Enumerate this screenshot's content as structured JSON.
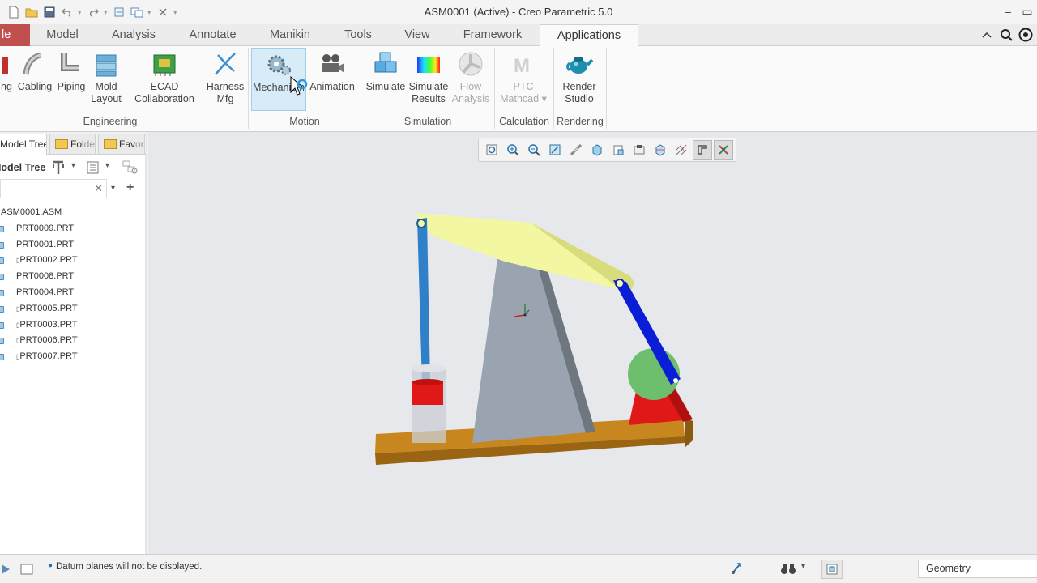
{
  "window": {
    "title": "ASM0001 (Active) - Creo Parametric 5.0"
  },
  "quick_access": [
    "new-icon",
    "open-icon",
    "save-icon",
    "undo-icon",
    "redo-icon",
    "regenerate-icon",
    "windows-icon",
    "close-icon",
    "customize-icon"
  ],
  "tabs": [
    {
      "label": "le",
      "name": "tab-file"
    },
    {
      "label": "Model",
      "name": "tab-model"
    },
    {
      "label": "Analysis",
      "name": "tab-analysis"
    },
    {
      "label": "Annotate",
      "name": "tab-annotate"
    },
    {
      "label": "Manikin",
      "name": "tab-manikin"
    },
    {
      "label": "Tools",
      "name": "tab-tools"
    },
    {
      "label": "View",
      "name": "tab-view"
    },
    {
      "label": "Framework",
      "name": "tab-framework"
    },
    {
      "label": "Applications",
      "name": "tab-applications",
      "active": true
    }
  ],
  "ribbon": {
    "buttons": [
      {
        "label1": "ng",
        "label2": ""
      },
      {
        "label1": "Cabling",
        "label2": ""
      },
      {
        "label1": "Piping",
        "label2": ""
      },
      {
        "label1": "Mold",
        "label2": "Layout"
      },
      {
        "label1": "ECAD",
        "label2": "Collaboration"
      },
      {
        "label1": "Harness",
        "label2": "Mfg"
      },
      {
        "label1": "Mechanism",
        "label2": ""
      },
      {
        "label1": "Animation",
        "label2": ""
      },
      {
        "label1": "Simulate",
        "label2": ""
      },
      {
        "label1": "Simulate",
        "label2": "Results"
      },
      {
        "label1": "Flow",
        "label2": "Analysis"
      },
      {
        "label1": "PTC",
        "label2": "Mathcad"
      },
      {
        "label1": "Render",
        "label2": "Studio"
      }
    ],
    "groups": [
      "Engineering",
      "Motion",
      "Simulation",
      "Calculation",
      "Rendering"
    ]
  },
  "left_panel": {
    "tabs": [
      {
        "label": "Model Tree",
        "hidden": ""
      },
      {
        "label": "Fol",
        "hidden": "ders"
      },
      {
        "label": "Fav",
        "hidden": "orites"
      }
    ],
    "tree_label": "Model Tree",
    "tree": [
      {
        "label": "ASM0001.ASM"
      },
      {
        "label": "PRT0009.PRT"
      },
      {
        "label": "PRT0001.PRT"
      },
      {
        "label": "PRT0002.PRT"
      },
      {
        "label": "PRT0008.PRT"
      },
      {
        "label": "PRT0004.PRT"
      },
      {
        "label": "PRT0005.PRT"
      },
      {
        "label": "PRT0003.PRT"
      },
      {
        "label": "PRT0006.PRT"
      },
      {
        "label": "PRT0007.PRT"
      }
    ]
  },
  "status": {
    "message": "Datum planes will not be displayed.",
    "filter": "Geometry"
  },
  "colors": {
    "file_tab": "#c0504d",
    "beam": "#f3f7a2",
    "frame": "#9aa3b0",
    "link_blue": "#0a1ed8",
    "rod_blue": "#2f80c8",
    "disk_green": "#6dbf6d",
    "red_part": "#e01818",
    "base": "#c8861e"
  }
}
